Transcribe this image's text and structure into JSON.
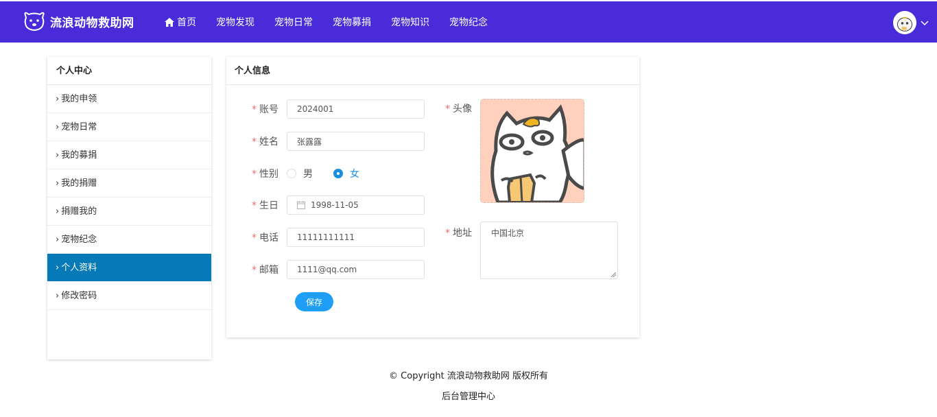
{
  "brand": {
    "name": "流浪动物救助网"
  },
  "nav": {
    "items": [
      {
        "label": "首页",
        "icon": "home-icon"
      },
      {
        "label": "宠物发现"
      },
      {
        "label": "宠物日常"
      },
      {
        "label": "宠物募捐"
      },
      {
        "label": "宠物知识"
      },
      {
        "label": "宠物纪念"
      }
    ]
  },
  "sidebar": {
    "title": "个人中心",
    "items": [
      {
        "label": "我的申领"
      },
      {
        "label": "宠物日常"
      },
      {
        "label": "我的募捐"
      },
      {
        "label": "我的捐赠"
      },
      {
        "label": "捐赠我的"
      },
      {
        "label": "宠物纪念"
      },
      {
        "label": "个人资料",
        "active": true
      },
      {
        "label": "修改密码"
      }
    ]
  },
  "panel": {
    "title": "个人信息",
    "fields": {
      "account": {
        "label": "账号",
        "value": "2024001"
      },
      "name": {
        "label": "姓名",
        "value": "张露露"
      },
      "gender": {
        "label": "性别",
        "options": [
          "男",
          "女"
        ],
        "selected": "女"
      },
      "birthday": {
        "label": "生日",
        "value": "1998-11-05"
      },
      "phone": {
        "label": "电话",
        "value": "11111111111"
      },
      "email": {
        "label": "邮箱",
        "value": "1111@qq.com"
      },
      "avatar": {
        "label": "头像"
      },
      "address": {
        "label": "地址",
        "value": "中国北京"
      }
    },
    "save_label": "保存"
  },
  "footer": {
    "copyright": "© Copyright 流浪动物救助网 版权所有",
    "admin_link": "后台管理中心"
  },
  "colors": {
    "navbar": "#4a2bd9",
    "active_sidebar": "#0679b7",
    "primary_button": "#1e9ef4",
    "required_star": "#f56c6c"
  }
}
